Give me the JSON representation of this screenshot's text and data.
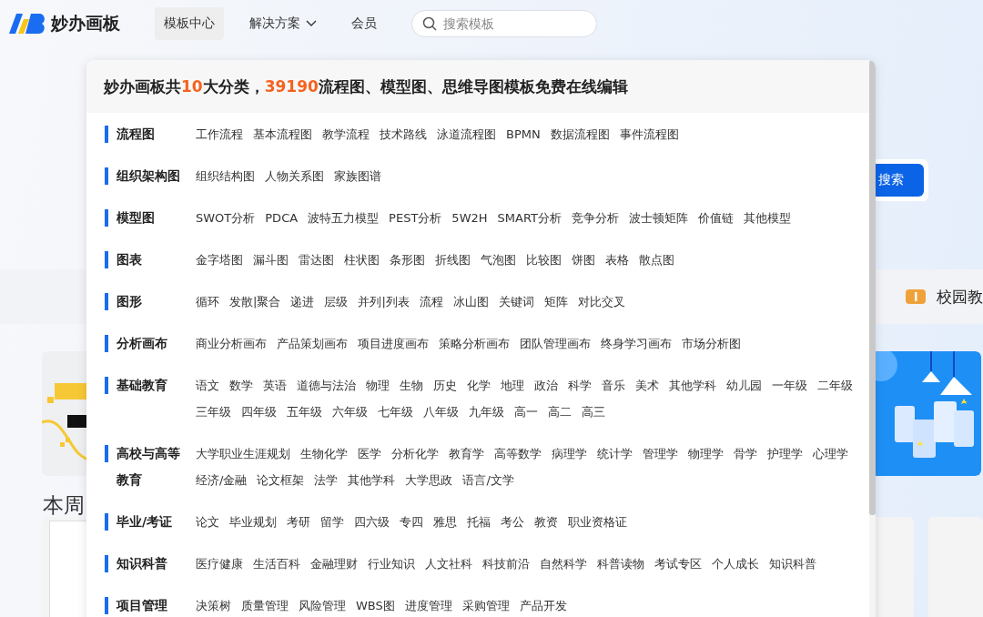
{
  "header": {
    "logo_text": "妙办画板",
    "nav": [
      {
        "label": "模板中心",
        "selected": true,
        "kind": "link"
      },
      {
        "label": "解决方案",
        "selected": false,
        "kind": "dropdown"
      },
      {
        "label": "会员",
        "selected": false,
        "kind": "link"
      }
    ],
    "search": {
      "placeholder": "搜索模板"
    }
  },
  "page": {
    "search_button": "搜索",
    "category_band": {
      "label": "校园教"
    },
    "section_title": "本周"
  },
  "panel": {
    "title_parts": [
      {
        "text": "妙办画板共",
        "highlight": false
      },
      {
        "text": "10",
        "highlight": true
      },
      {
        "text": "大分类，",
        "highlight": false
      },
      {
        "text": "39190",
        "highlight": true
      },
      {
        "text": "流程图、模型图、思维导图模板免费在线编辑",
        "highlight": false
      }
    ],
    "categories": [
      {
        "label": "流程图",
        "items": [
          "工作流程",
          "基本流程图",
          "教学流程",
          "技术路线",
          "泳道流程图",
          "BPMN",
          "数据流程图",
          "事件流程图"
        ]
      },
      {
        "label": "组织架构图",
        "items": [
          "组织结构图",
          "人物关系图",
          "家族图谱"
        ]
      },
      {
        "label": "模型图",
        "items": [
          "SWOT分析",
          "PDCA",
          "波特五力模型",
          "PEST分析",
          "5W2H",
          "SMART分析",
          "竞争分析",
          "波士顿矩阵",
          "价值链",
          "其他模型"
        ]
      },
      {
        "label": "图表",
        "items": [
          "金字塔图",
          "漏斗图",
          "雷达图",
          "柱状图",
          "条形图",
          "折线图",
          "气泡图",
          "比较图",
          "饼图",
          "表格",
          "散点图"
        ]
      },
      {
        "label": "图形",
        "items": [
          "循环",
          "发散|聚合",
          "递进",
          "层级",
          "并列|列表",
          "流程",
          "冰山图",
          "关键词",
          "矩阵",
          "对比交叉"
        ]
      },
      {
        "label": "分析画布",
        "items": [
          "商业分析画布",
          "产品策划画布",
          "项目进度画布",
          "策略分析画布",
          "团队管理画布",
          "终身学习画布",
          "市场分析图"
        ]
      },
      {
        "label": "基础教育",
        "items": [
          "语文",
          "数学",
          "英语",
          "道德与法治",
          "物理",
          "生物",
          "历史",
          "化学",
          "地理",
          "政治",
          "科学",
          "音乐",
          "美术",
          "其他学科",
          "幼儿园",
          "一年级",
          "二年级",
          "三年级",
          "四年级",
          "五年级",
          "六年级",
          "七年级",
          "八年级",
          "九年级",
          "高一",
          "高二",
          "高三"
        ]
      },
      {
        "label": "高校与高等教育",
        "items": [
          "大学职业生涯规划",
          "生物化学",
          "医学",
          "分析化学",
          "教育学",
          "高等数学",
          "病理学",
          "统计学",
          "管理学",
          "物理学",
          "骨学",
          "护理学",
          "心理学",
          "经济/金融",
          "论文框架",
          "法学",
          "其他学科",
          "大学思政",
          "语言/文学"
        ]
      },
      {
        "label": "毕业/考证",
        "items": [
          "论文",
          "毕业规划",
          "考研",
          "留学",
          "四六级",
          "专四",
          "雅思",
          "托福",
          "考公",
          "教资",
          "职业资格证"
        ]
      },
      {
        "label": "知识科普",
        "items": [
          "医疗健康",
          "生活百科",
          "金融理财",
          "行业知识",
          "人文社科",
          "科技前沿",
          "自然科学",
          "科普读物",
          "考试专区",
          "个人成长",
          "知识科普"
        ]
      },
      {
        "label": "项目管理",
        "items": [
          "决策树",
          "质量管理",
          "风险管理",
          "WBS图",
          "进度管理",
          "采购管理",
          "产品开发"
        ]
      }
    ]
  }
}
